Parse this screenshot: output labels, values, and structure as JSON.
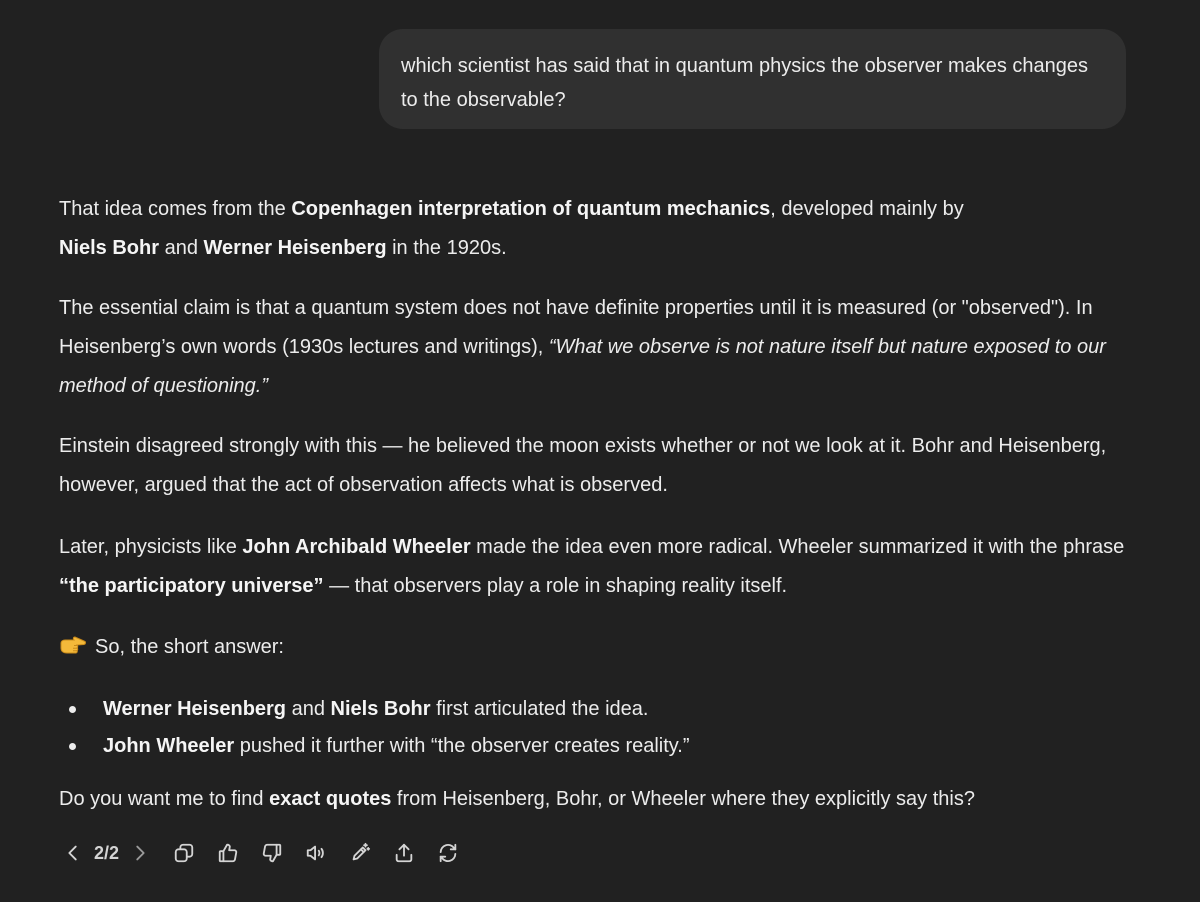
{
  "user_message": {
    "text": "which scientist has said that in quantum physics the observer makes changes to the observable?"
  },
  "assistant": {
    "p1": {
      "t1": "That idea comes from the ",
      "b1": "Copenhagen interpretation of quantum mechanics",
      "t2": ", developed mainly by ",
      "b2": "Niels Bohr",
      "t3": " and ",
      "b3": "Werner Heisenberg",
      "t4": " in the 1920s."
    },
    "p2": {
      "t1": "The essential claim is that a quantum system does not have definite properties until it is measured (or \"observed\"). In Heisenberg’s own words (1930s lectures and writings), ",
      "i1": "“What we observe is not nature itself but nature exposed to our method of questioning.”"
    },
    "p3": {
      "t1": "Einstein disagreed strongly with this — he believed the moon exists whether or not we look at it. Bohr and Heisenberg, however, argued that the act of observation affects what is observed."
    },
    "p4": {
      "t1": "Later, physicists like ",
      "b1": "John Archibald Wheeler",
      "t2": " made the idea even more radical. Wheeler summarized it with the phrase ",
      "b2": "“the participatory universe”",
      "t3": " — that observers play a role in shaping reality itself."
    },
    "p5": {
      "emoji": "pointing-right-hand",
      "t1": "So, the short answer:"
    },
    "bullets": [
      {
        "b1": "Werner Heisenberg",
        "t1": " and ",
        "b2": "Niels Bohr",
        "t2": " first articulated the idea."
      },
      {
        "b1": "John Wheeler",
        "t1": " pushed it further with “the observer creates reality.”"
      }
    ],
    "p6": {
      "t1": "Do you want me to find ",
      "b1": "exact quotes",
      "t2": " from Heisenberg, Bohr, or Wheeler where they explicitly say this?"
    }
  },
  "toolbar": {
    "pager": "2/2",
    "icons": [
      "chevron-left-icon",
      "chevron-right-icon",
      "copy-icon",
      "thumbs-up-icon",
      "thumbs-down-icon",
      "speaker-icon",
      "edit-icon",
      "share-icon",
      "regenerate-icon"
    ]
  }
}
